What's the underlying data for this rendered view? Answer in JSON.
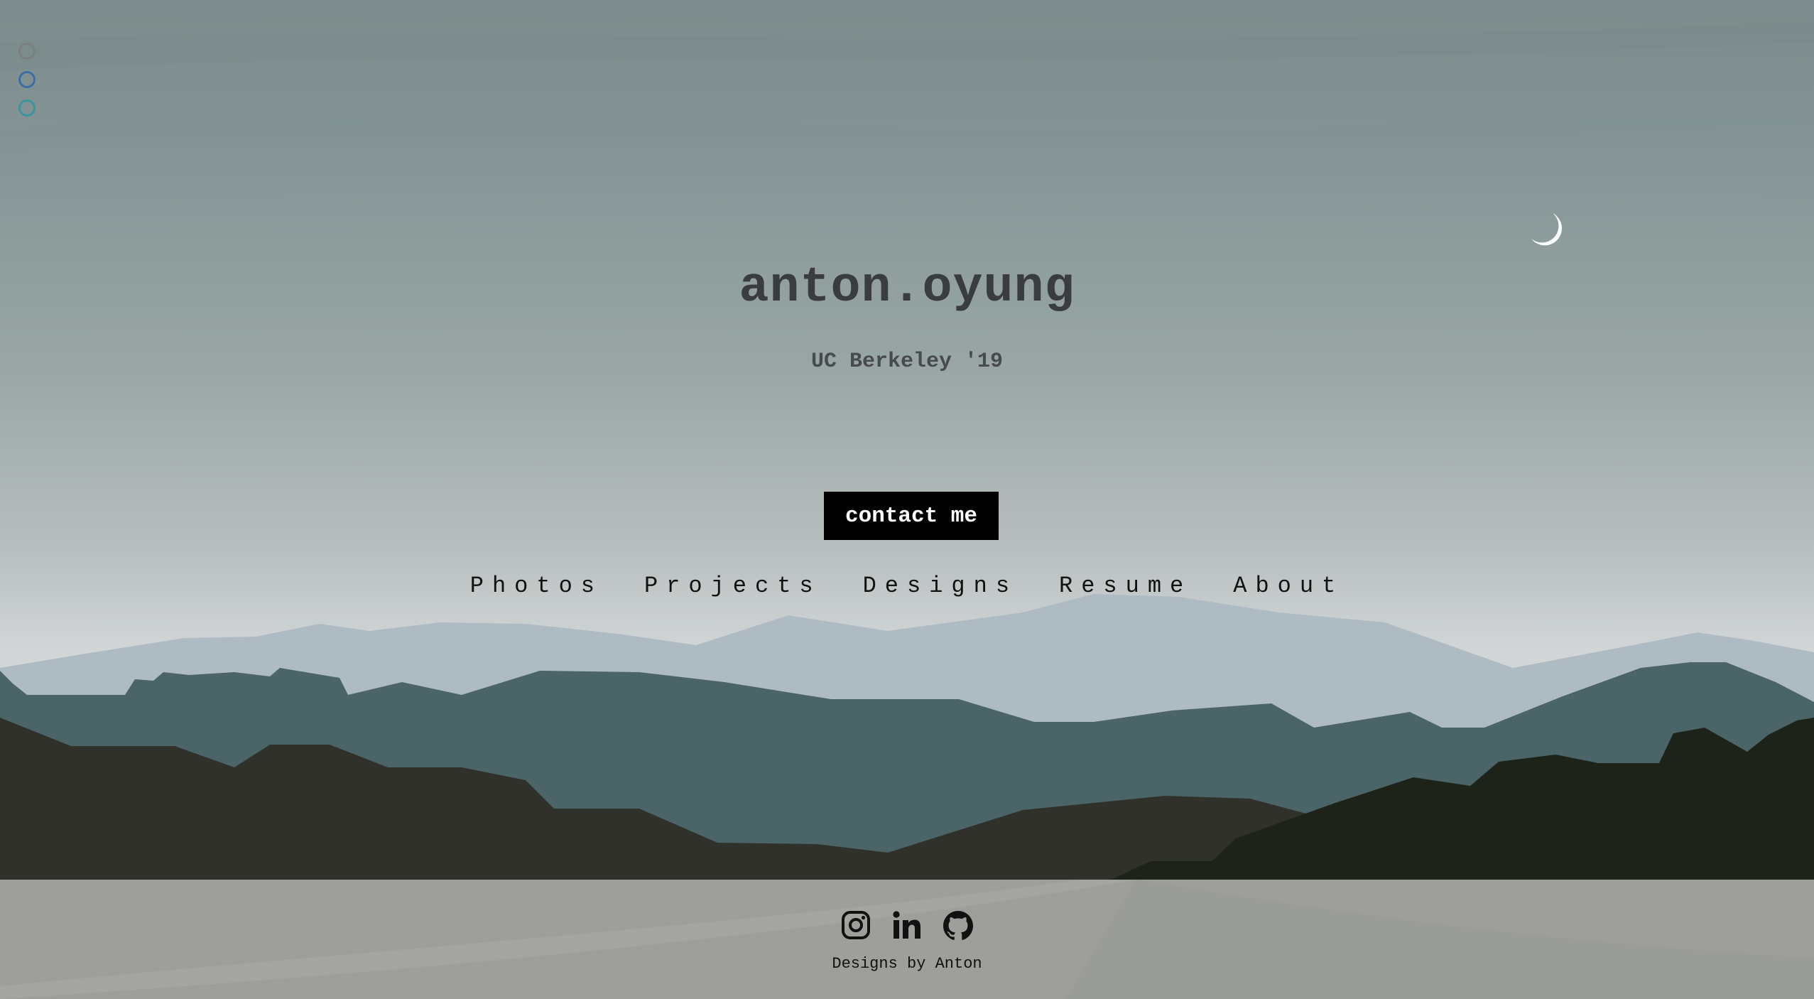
{
  "header": {
    "title": "anton.oyung",
    "subtitle": "UC Berkeley '19"
  },
  "contact_button": {
    "label": "contact me"
  },
  "nav": {
    "items": [
      {
        "label": "Photos"
      },
      {
        "label": "Projects"
      },
      {
        "label": "Designs"
      },
      {
        "label": "Resume"
      },
      {
        "label": "About"
      }
    ]
  },
  "window_controls": {
    "colors": [
      "#7a7f7f",
      "#3a6fa6",
      "#3a93a0"
    ]
  },
  "footer": {
    "socials": [
      {
        "icon": "instagram-icon"
      },
      {
        "icon": "linkedin-icon"
      },
      {
        "icon": "github-icon"
      }
    ],
    "credit": "Designs by Anton"
  },
  "colors": {
    "sky_top": "#7c8b8b",
    "sky_bottom": "#d3d7d8",
    "mountain_far": "#aebbc3",
    "mountain_mid": "#4a6467",
    "mountain_near": "#30312b",
    "mountain_front": "#1e231a",
    "footer_bg": "#9e9f9b",
    "button_bg": "#000000"
  }
}
